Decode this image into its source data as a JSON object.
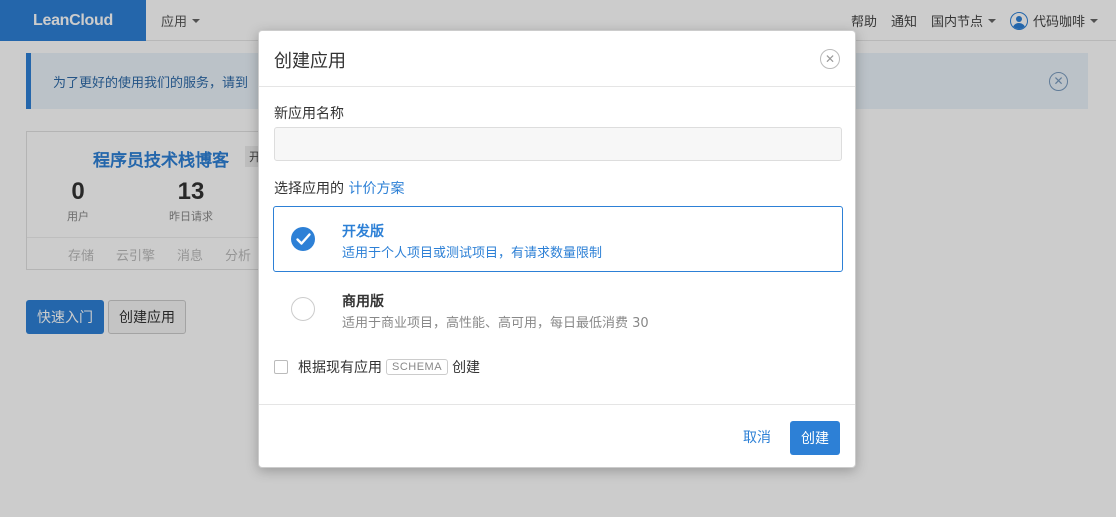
{
  "topbar": {
    "logo": "LeanCloud",
    "app_menu": "应用",
    "help": "帮助",
    "notify": "通知",
    "region": "国内节点",
    "user": "代码咖啡"
  },
  "notice": {
    "text": "为了更好的使用我们的服务，请到"
  },
  "app_card": {
    "name": "程序员技术栈博客",
    "tag": "开",
    "stats": [
      {
        "value": "0",
        "label": "用户"
      },
      {
        "value": "13",
        "label": "昨日请求"
      }
    ],
    "footer_items": [
      "存储",
      "云引擎",
      "消息",
      "分析"
    ]
  },
  "actions": {
    "quick_start": "快速入门",
    "create_app": "创建应用"
  },
  "modal": {
    "title": "创建应用",
    "name_label": "新应用名称",
    "name_value": "",
    "plan_label": "选择应用的",
    "plan_link": "计价方案",
    "plans": [
      {
        "name": "开发版",
        "desc": "适用于个人项目或测试项目，有请求数量限制",
        "selected": true
      },
      {
        "name": "商用版",
        "desc": "适用于商业项目，高性能、高可用，每日最低消费 30",
        "selected": false
      }
    ],
    "schema_prefix": "根据现有应用",
    "schema_tag": "SCHEMA",
    "schema_suffix": "创建",
    "cancel": "取消",
    "submit": "创建"
  },
  "colors": {
    "accent": "#2d80d6"
  }
}
